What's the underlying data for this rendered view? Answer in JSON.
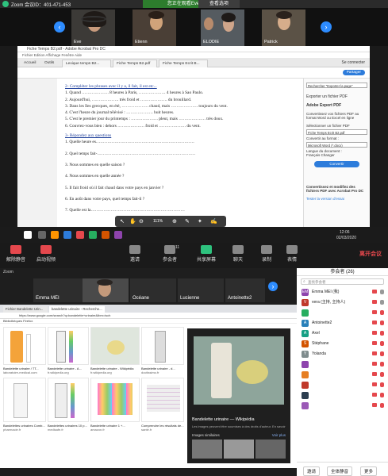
{
  "top_zoom": {
    "title": "Zoom 会议ID：401-471-453",
    "speaking": "您正在观看Eve的屏幕",
    "view_options": "查看选项",
    "participants": [
      {
        "name": "Eve"
      },
      {
        "name": "Etienn"
      },
      {
        "name": "ELODIE"
      },
      {
        "name": "Patrick"
      }
    ]
  },
  "acrobat": {
    "window_title": "Fiche Temps B2.pdf - Adobe Acrobat Pro DC",
    "menu": "Fichier  Edition  Affichage  Fenêtre  Aide",
    "tabs": [
      "Accueil",
      "Outils",
      "Lexique temps B2...",
      "Fiche Temps B2.pdf",
      "Fiche Temps Ecrit B..."
    ],
    "signin": "Se connecter",
    "share": "Partager",
    "page_lines": [
      {
        "text": "2-   Compléter les phrases avec il y a, il fait, il est etc...",
        "h": true
      },
      {
        "text": "1.   Quand ………………. 8 heures à Paris, ………………. 4 heures à Sao Paulo."
      },
      {
        "text": "2.   Aujourd'hui, ………………. très froid et ………………. du brouillard."
      },
      {
        "text": "3.   Dans les îles grecques, en été, ………………. chaud, mais ………………. toujours du vent."
      },
      {
        "text": "4.   C'est l'heure du journal télévisé : ………………. huit heures."
      },
      {
        "text": "5.   C'est le premier jour du printemps : ………………. pleut, mais ………………. très doux."
      },
      {
        "text": "6.   Couvrez-vous bien : dehors ………………. froid et ………………. du vent."
      },
      {
        "text": "3-   Répondez aux questions",
        "h": true
      },
      {
        "text": "1.   Quelle heure es……………………………………………………………"
      },
      {
        "text": "2.   Quel temps fait-……………………………………………………………"
      },
      {
        "text": "3.   Nous sommes en quelle saison ?"
      },
      {
        "text": "4.   Nous sommes en quelle année ?"
      },
      {
        "text": "5.   Il fait froid où il fait chaud dans votre pays en janvier ?"
      },
      {
        "text": "6.   En août dans votre pays, quel temps fait-il ?"
      },
      {
        "text": "7.   Quelle est la…………………………………………………………"
      }
    ],
    "side": {
      "search_placeholder": "Rechercher \"Exporter la page\"",
      "export_title": "Exporter un fichier PDF",
      "export_product": "Adobe Export PDF",
      "export_desc": "Convertissez vos fichiers PDF au format Word ou Excel en ligne",
      "select_label": "Sélectionner un fichier PDF",
      "file": "Fiche Temps Ecrit B2.pdf",
      "convert_label": "Convertir au format :",
      "format": "Microsoft Word (*.docx)",
      "lang_label": "Langue du document :",
      "lang": "Français  Changer",
      "convert_btn": "Convertir",
      "promo": "Convertissez et modifiez des fichiers PDF avec Acrobat Pro DC",
      "trial": "Tester la version d'essai"
    },
    "zoom_level": "111%"
  },
  "taskbar": {
    "time": "12:06",
    "date": "02/03/2020"
  },
  "controls": [
    {
      "label": "解除静音",
      "color": "#e5484d"
    },
    {
      "label": "启动视频",
      "color": "#e5484d"
    },
    {
      "label": "邀请",
      "color": "#888"
    },
    {
      "label": "参会者",
      "color": "#888",
      "count": "11"
    },
    {
      "label": "共享屏幕",
      "color": "#2ec27e"
    },
    {
      "label": "聊天",
      "color": "#888"
    },
    {
      "label": "录制",
      "color": "#888"
    },
    {
      "label": "表情",
      "color": "#888"
    }
  ],
  "leave": "离开会议",
  "bottom_zoom": {
    "title": "Zoom",
    "participants": [
      {
        "name": "Emma MEI"
      },
      {
        "name": ""
      },
      {
        "name": "Océane"
      },
      {
        "name": "Lucienne"
      },
      {
        "name": "Antoinette2"
      }
    ],
    "browser": {
      "tabs": [
        "Fichier Bandelette Urin...",
        "bandelette urinaire - Recherche..."
      ],
      "url": "https://www.google.com/search?q=bandelette+urinaire&tbm=isch",
      "bookmarks": "Bibliothèques Firefox",
      "results": [
        {
          "title": "Bandelette urinaire / TT...",
          "source": "laboratoire-medical.com"
        },
        {
          "title": "Bandelette urinaire - A...",
          "source": "fr.wikipedia.org"
        },
        {
          "title": "Bandelette urinaire - Wikipédia",
          "source": "fr.wikipedia.org"
        },
        {
          "title": "Bandelette urinaire - d...",
          "source": "doctissimo.fr"
        },
        {
          "title": "Bandelettes urinaires Comb...",
          "source": "pharmacie.fr"
        },
        {
          "title": "Bandelettes urinaires 10 p...",
          "source": "medisafe.fr"
        },
        {
          "title": "Bandelette urinaire 1 +...",
          "source": "amazon.fr"
        },
        {
          "title": "Comprendre les résultats de...",
          "source": "santé.fr"
        }
      ],
      "preview_title": "Bandelette urinaire — Wikipédia",
      "preview_desc": "Les images peuvent être soumises à des droits d'auteur. En savoir plus",
      "preview_section": "Images similaires",
      "preview_more": "Voir plus"
    },
    "panel": {
      "header": "参会者 (26)",
      "search": "查找参会者",
      "list": [
        {
          "name": "Emma MEI (我)",
          "color": "#8e44ad",
          "initial": "EM",
          "mic_off": false
        },
        {
          "name": "vera (主持, 主持人)",
          "color": "#c0392b",
          "initial": "V",
          "mic_off": false
        },
        {
          "name": "",
          "color": "#27ae60",
          "initial": "",
          "mic_off": true
        },
        {
          "name": "Antoinette2",
          "color": "#2980b9",
          "initial": "A",
          "mic_off": true
        },
        {
          "name": "Axel",
          "color": "#16a085",
          "initial": "A",
          "mic_off": true
        },
        {
          "name": "Stéphane",
          "color": "#d35400",
          "initial": "S",
          "mic_off": true
        },
        {
          "name": "Yolanda",
          "color": "#7f8c8d",
          "initial": "Y",
          "mic_off": true
        },
        {
          "name": "",
          "color": "#8e44ad",
          "initial": "",
          "mic_off": true
        },
        {
          "name": "",
          "color": "#e67e22",
          "initial": "",
          "mic_off": true
        },
        {
          "name": "",
          "color": "#c0392b",
          "initial": "",
          "mic_off": true
        },
        {
          "name": "",
          "color": "#2c3e50",
          "initial": "",
          "mic_off": true
        },
        {
          "name": "",
          "color": "#9b59b6",
          "initial": "",
          "mic_off": true
        }
      ],
      "invite": "邀请",
      "mute_all": "全体静音",
      "more": "更多"
    }
  }
}
